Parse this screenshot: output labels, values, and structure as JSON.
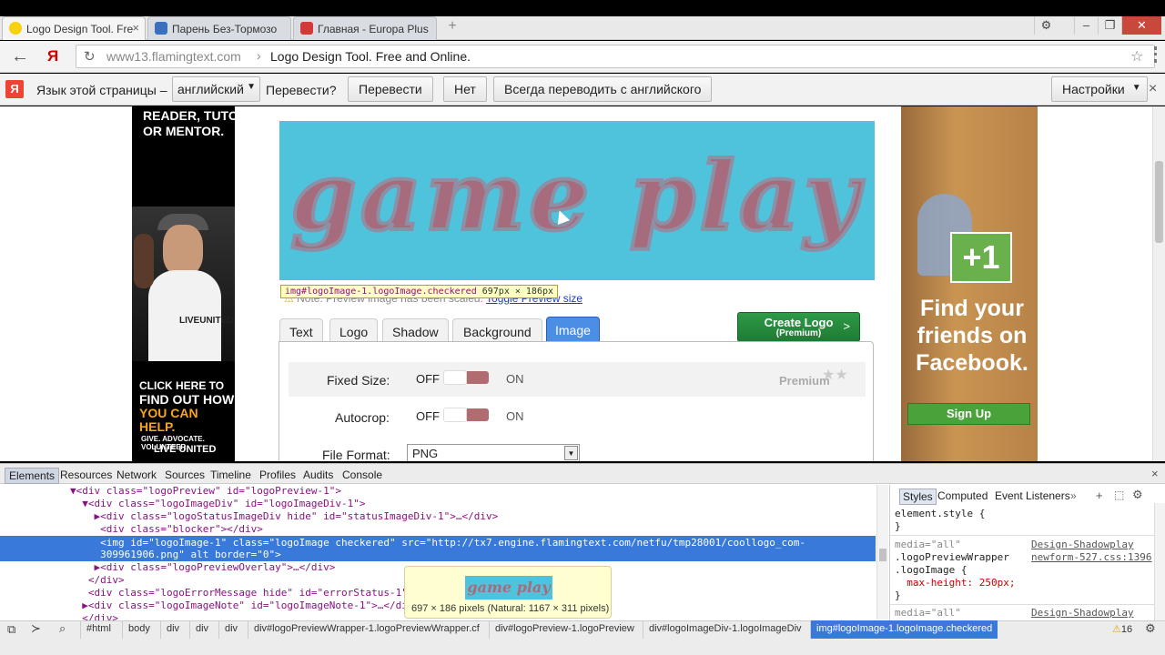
{
  "browser": {
    "tabs": [
      {
        "title": "Logo Design Tool. Fre"
      },
      {
        "title": "Парень Без-Тормозо"
      },
      {
        "title": "Главная - Europa Plus"
      }
    ],
    "url_host": "www13.flamingtext.com",
    "url_rest": "Logo Design Tool. Free and Online."
  },
  "translate_bar": {
    "prompt": "Язык этой страницы –",
    "language": "английский",
    "question": "Перевести?",
    "translate_btn": "Перевести",
    "no_btn": "Нет",
    "always_btn": "Всегда переводить с английского",
    "settings_btn": "Настройки"
  },
  "left_ad": {
    "top_text": "READER, TUTOR\nOR MENTOR.",
    "shirt_text": "LIVEUNITED",
    "cta_line1": "CLICK HERE TO",
    "cta_line2": "FIND OUT HOW",
    "cta_line3": "YOU CAN HELP.",
    "slogan1": "GIVE. ADVOCATE. VOLUNTEER.",
    "slogan2": "LIVE UNITED"
  },
  "logo_preview": {
    "logo_text": "game play",
    "bg_color": "#4fc3dc",
    "tooltip_selector": "img#logoImage-1.logoImage.checkered",
    "tooltip_size": "697px × 186px",
    "note_text": "Note: Preview image has been scaled.",
    "note_link": "Toggle Preview size"
  },
  "editor": {
    "tabs": [
      "Text",
      "Logo",
      "Shadow",
      "Background",
      "Image"
    ],
    "active_tab": "Image",
    "create_btn": "Create Logo",
    "create_sub": "(Premium)",
    "premium_label": "Premium",
    "rows": [
      {
        "label": "Fixed Size:",
        "off": "OFF",
        "on": "ON"
      },
      {
        "label": "Autocrop:",
        "off": "OFF",
        "on": "ON"
      }
    ],
    "file_format_label": "File Format:",
    "file_format_value": "PNG"
  },
  "right_ad": {
    "plus_text": "+1",
    "line1": "Find your",
    "line2": "friends on",
    "line3": "Facebook.",
    "signup_btn": "Sign Up"
  },
  "devtools": {
    "tabs": [
      "Elements",
      "Resources",
      "Network",
      "Sources",
      "Timeline",
      "Profiles",
      "Audits",
      "Console"
    ],
    "active_tab": "Elements",
    "code_lines": [
      "▼<div class=\"logoPreview\" id=\"logoPreview-1\">",
      "  ▼<div class=\"logoImageDiv\" id=\"logoImageDiv-1\">",
      "    ▶<div class=\"logoStatusImageDiv hide\" id=\"statusImageDiv-1\">…</div>",
      "     <div class=\"blocker\"></div>",
      "     <img id=\"logoImage-1\" class=\"logoImage checkered\" src=\"http://tx7.engine.flamingtext.com/netfu/tmp28001/coollogo_com-",
      "     309961906.png\" alt border=\"0\">",
      "    ▶<div class=\"logoPreviewOverlay\">…</div>",
      "   </div>",
      "   <div class=\"logoErrorMessage hide\" id=\"errorStatus-1\"",
      "  ▶<div class=\"logoImageNote\" id=\"logoImageNote-1\">…</di",
      "  </div>"
    ],
    "hover_logo": "game play",
    "hover_caption": "697 × 186 pixels (Natural: 1167 × 311 pixels)",
    "styles_tabs": [
      "Styles",
      "Computed",
      "Event Listeners",
      "»"
    ],
    "style_lines": [
      "element.style {",
      "}",
      "media=\"all\"",
      ".logoPreviewWrapper",
      ".logoImage {",
      "  max-height: 250px;",
      "}",
      "media=\"all\""
    ],
    "style_src1": "Design-Shadowplay",
    "style_src2": "newform-527.css:1396",
    "style_src3": "Design-Shadowplay",
    "breadcrumbs": [
      "#html",
      "body",
      "div",
      "div",
      "div",
      "div#logoPreviewWrapper-1.logoPreviewWrapper.cf",
      "div#logoPreview-1.logoPreview",
      "div#logoImageDiv-1.logoImageDiv",
      "img#logoImage-1.logoImage.checkered"
    ],
    "warnings": "16"
  }
}
